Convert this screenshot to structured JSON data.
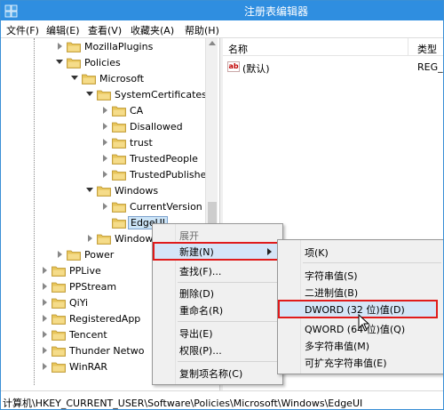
{
  "window": {
    "title": "注册表编辑器"
  },
  "menu": [
    "文件(F)",
    "编辑(E)",
    "查看(V)",
    "收藏夹(A)",
    "帮助(H)"
  ],
  "tree": {
    "items": [
      {
        "label": "MozillaPlugins",
        "indent": 0,
        "expander": "right"
      },
      {
        "label": "Policies",
        "indent": 0,
        "expander": "down"
      },
      {
        "label": "Microsoft",
        "indent": 1,
        "expander": "down"
      },
      {
        "label": "SystemCertificates",
        "indent": 2,
        "expander": "down"
      },
      {
        "label": "CA",
        "indent": 3,
        "expander": "right"
      },
      {
        "label": "Disallowed",
        "indent": 3,
        "expander": "right"
      },
      {
        "label": "trust",
        "indent": 3,
        "expander": "right"
      },
      {
        "label": "TrustedPeople",
        "indent": 3,
        "expander": "right"
      },
      {
        "label": "TrustedPublisher",
        "indent": 3,
        "expander": "right"
      },
      {
        "label": "Windows",
        "indent": 2,
        "expander": "down"
      },
      {
        "label": "CurrentVersion",
        "indent": 3,
        "expander": "right"
      },
      {
        "label": "EdgeUI",
        "indent": 3,
        "expander": "none",
        "selected": true
      },
      {
        "label": "Windows",
        "indent": 2,
        "expander": "right"
      },
      {
        "label": "Power",
        "indent": 0,
        "expander": "right"
      },
      {
        "label": "PPLive",
        "indent": -1,
        "expander": "right"
      },
      {
        "label": "PPStream",
        "indent": -1,
        "expander": "right"
      },
      {
        "label": "QiYi",
        "indent": -1,
        "expander": "right"
      },
      {
        "label": "RegisteredApp",
        "indent": -1,
        "expander": "right"
      },
      {
        "label": "Tencent",
        "indent": -1,
        "expander": "right"
      },
      {
        "label": "Thunder Netwo",
        "indent": -1,
        "expander": "right"
      },
      {
        "label": "WinRAR",
        "indent": -1,
        "expander": "right"
      }
    ]
  },
  "list": {
    "columns": [
      "名称",
      "类型"
    ],
    "rows": [
      {
        "name": "(默认)",
        "type": "REG_S",
        "icon": "ab-string-icon"
      }
    ]
  },
  "context_menu": {
    "items": [
      {
        "label": "展开",
        "dim": true
      },
      {
        "label": "新建(N)",
        "highlight": true,
        "submenu": true
      },
      {
        "label": "查找(F)..."
      },
      {
        "label": "删除(D)"
      },
      {
        "label": "重命名(R)"
      },
      {
        "label": "导出(E)"
      },
      {
        "label": "权限(P)..."
      },
      {
        "label": "复制项名称(C)"
      }
    ]
  },
  "submenu": {
    "items": [
      {
        "label": "项(K)"
      },
      {
        "label": "字符串值(S)"
      },
      {
        "label": "二进制值(B)"
      },
      {
        "label": "DWORD (32 位)值(D)",
        "highlight": true
      },
      {
        "label": "QWORD (64 位)值(Q)"
      },
      {
        "label": "多字符串值(M)"
      },
      {
        "label": "可扩充字符串值(E)"
      }
    ]
  },
  "status": {
    "path": "计算机\\HKEY_CURRENT_USER\\Software\\Policies\\Microsoft\\Windows\\EdgeUI"
  },
  "colors": {
    "title_bar": "#2f8ee0",
    "highlight_border": "#e01b1b",
    "folder": "#e8c55a"
  }
}
